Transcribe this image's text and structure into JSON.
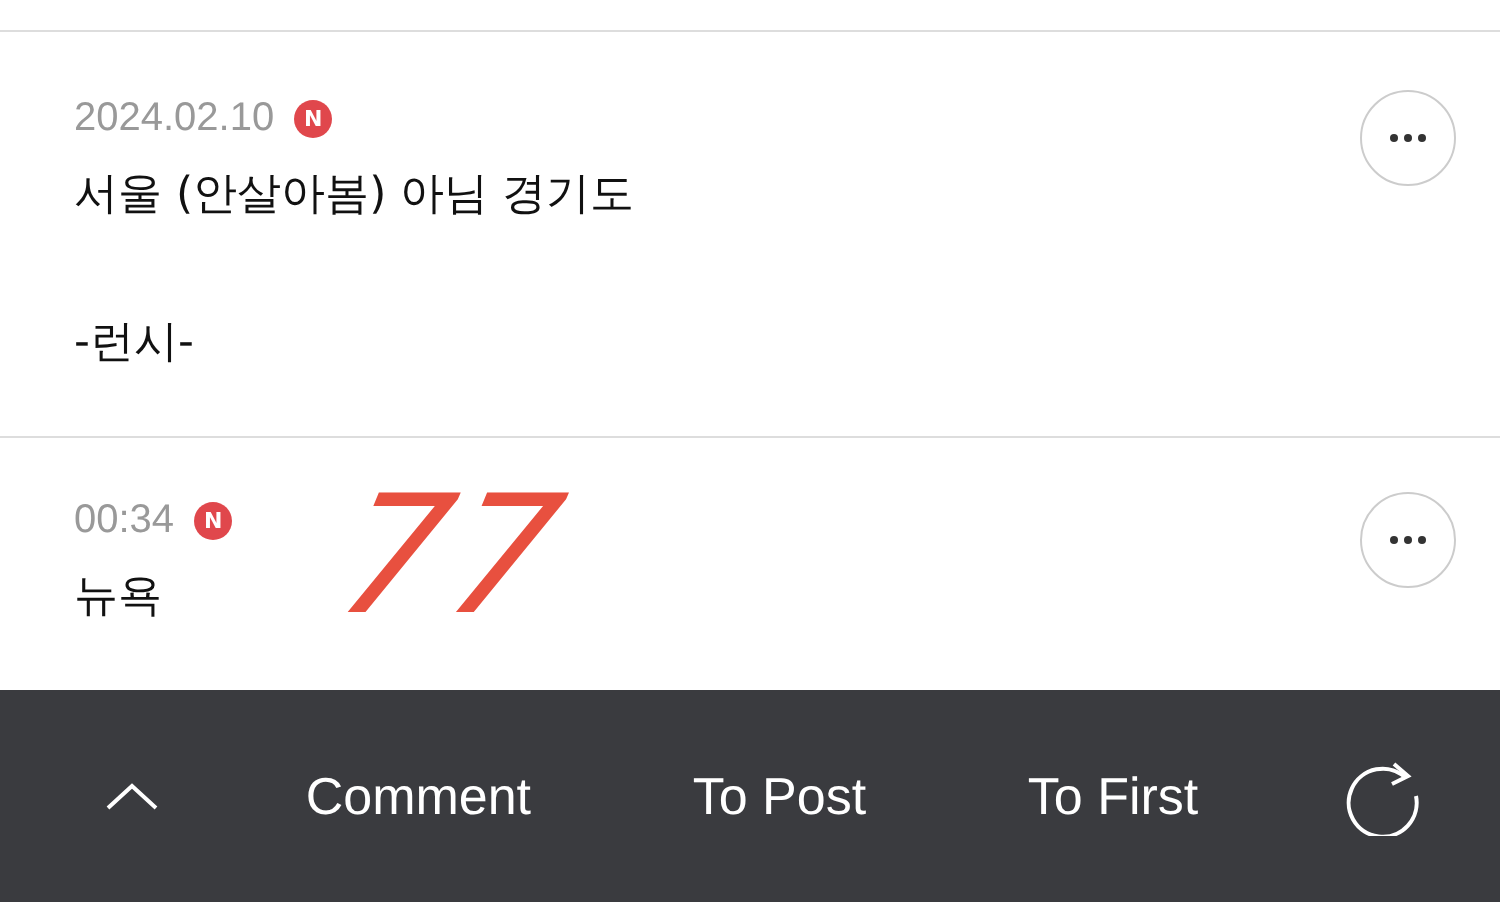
{
  "comments": [
    {
      "time": "2024.02.10",
      "badge": "N",
      "text": "서울 (안살아봄) 아님 경기도\n\n-런시-"
    },
    {
      "time": "00:34",
      "badge": "N",
      "text": "뉴욕"
    }
  ],
  "handwritten_mark": "77",
  "toolbar": {
    "buttons": [
      {
        "label": "Comment"
      },
      {
        "label": "To Post"
      },
      {
        "label": "To First"
      }
    ]
  }
}
